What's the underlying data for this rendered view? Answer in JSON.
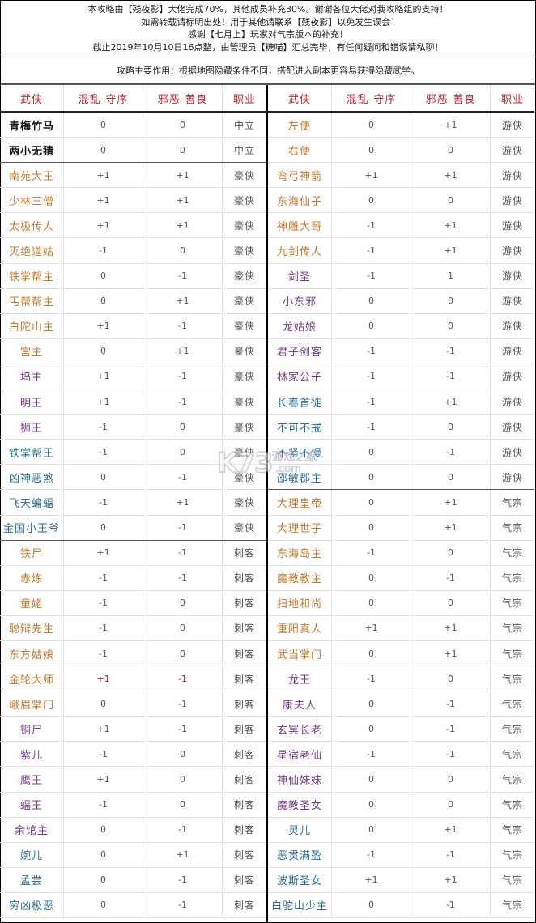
{
  "notice": {
    "lines": [
      "本攻略由【残夜影】大佬完成70%，其他成员补充30%。谢谢各位大佬对我攻略组的支持！",
      "如需转载请标明出处！用于其他请联系【残夜影】以免发生误会`",
      "感谢【七月上】玩家对气宗版本的补充！",
      "截止2019年10月10日16点整，由管理员【糖喵】汇总完毕，有任何疑问和错误请私聊！"
    ]
  },
  "purpose": "攻略主要作用：根据地图隐藏条件不同，搭配进入副本更容易获得隐藏武学。",
  "headers": [
    "武侠",
    "混乱-守序",
    "邪恶-善良",
    "职业"
  ],
  "colors": {
    "header": "#c0282f",
    "black": "#111111",
    "orange": "#c8782a",
    "purple": "#7a3a8c",
    "blue": "#2a6e9a",
    "highlight_value": "#b0202a"
  },
  "left_table": [
    {
      "name": "青梅竹马",
      "chaos_order": "0",
      "evil_good": "0",
      "job": "中立",
      "color": "black"
    },
    {
      "name": "两小无猜",
      "chaos_order": "0",
      "evil_good": "0",
      "job": "中立",
      "color": "black",
      "group_end": true
    },
    {
      "name": "南苑大王",
      "chaos_order": "+1",
      "evil_good": "+1",
      "job": "豪侠",
      "color": "orange"
    },
    {
      "name": "少林三僧",
      "chaos_order": "+1",
      "evil_good": "+1",
      "job": "豪侠",
      "color": "orange"
    },
    {
      "name": "太极传人",
      "chaos_order": "+1",
      "evil_good": "+1",
      "job": "豪侠",
      "color": "orange"
    },
    {
      "name": "灭绝道姑",
      "chaos_order": "-1",
      "evil_good": "0",
      "job": "豪侠",
      "color": "orange"
    },
    {
      "name": "铁掌帮主",
      "chaos_order": "0",
      "evil_good": "-1",
      "job": "豪侠",
      "color": "orange"
    },
    {
      "name": "丐帮帮主",
      "chaos_order": "0",
      "evil_good": "+1",
      "job": "豪侠",
      "color": "orange"
    },
    {
      "name": "白陀山主",
      "chaos_order": "+1",
      "evil_good": "-1",
      "job": "豪侠",
      "color": "orange"
    },
    {
      "name": "宫主",
      "chaos_order": "0",
      "evil_good": "+1",
      "job": "豪侠",
      "color": "orange"
    },
    {
      "name": "坞主",
      "chaos_order": "+1",
      "evil_good": "-1",
      "job": "豪侠",
      "color": "purple"
    },
    {
      "name": "明王",
      "chaos_order": "+1",
      "evil_good": "-1",
      "job": "豪侠",
      "color": "purple"
    },
    {
      "name": "狮王",
      "chaos_order": "-1",
      "evil_good": "0",
      "job": "豪侠",
      "color": "purple"
    },
    {
      "name": "铁掌帮王",
      "chaos_order": "-1",
      "evil_good": "0",
      "job": "豪侠",
      "color": "blue"
    },
    {
      "name": "凶神恶煞",
      "chaos_order": "0",
      "evil_good": "-1",
      "job": "豪侠",
      "color": "blue"
    },
    {
      "name": "飞天蝙蝠",
      "chaos_order": "-1",
      "evil_good": "+1",
      "job": "豪侠",
      "color": "blue"
    },
    {
      "name": "金国小王爷",
      "chaos_order": "0",
      "evil_good": "-1",
      "job": "豪侠",
      "color": "blue",
      "group_end": true
    },
    {
      "name": "铁尸",
      "chaos_order": "+1",
      "evil_good": "-1",
      "job": "刺客",
      "color": "orange"
    },
    {
      "name": "赤炼",
      "chaos_order": "-1",
      "evil_good": "-1",
      "job": "刺客",
      "color": "orange"
    },
    {
      "name": "童姥",
      "chaos_order": "-1",
      "evil_good": "0",
      "job": "刺客",
      "color": "orange"
    },
    {
      "name": "聪辩先生",
      "chaos_order": "-1",
      "evil_good": "0",
      "job": "刺客",
      "color": "orange"
    },
    {
      "name": "东方姑娘",
      "chaos_order": "-1",
      "evil_good": "0",
      "job": "刺客",
      "color": "orange"
    },
    {
      "name": "金轮大师",
      "chaos_order": "+1",
      "evil_good": "-1",
      "job": "刺客",
      "color": "orange",
      "values_highlight": true
    },
    {
      "name": "峨眉掌门",
      "chaos_order": "0",
      "evil_good": "-1",
      "job": "刺客",
      "color": "orange"
    },
    {
      "name": "铜尸",
      "chaos_order": "+1",
      "evil_good": "-1",
      "job": "刺客",
      "color": "purple"
    },
    {
      "name": "紫儿",
      "chaos_order": "-1",
      "evil_good": "0",
      "job": "刺客",
      "color": "purple"
    },
    {
      "name": "鹰王",
      "chaos_order": "+1",
      "evil_good": "0",
      "job": "刺客",
      "color": "purple"
    },
    {
      "name": "蝠王",
      "chaos_order": "-1",
      "evil_good": "0",
      "job": "刺客",
      "color": "purple"
    },
    {
      "name": "余馆主",
      "chaos_order": "0",
      "evil_good": "-1",
      "job": "刺客",
      "color": "purple"
    },
    {
      "name": "婉儿",
      "chaos_order": "0",
      "evil_good": "+1",
      "job": "刺客",
      "color": "blue"
    },
    {
      "name": "孟尝",
      "chaos_order": "0",
      "evil_good": "-1",
      "job": "刺客",
      "color": "blue"
    },
    {
      "name": "穷凶极恶",
      "chaos_order": "0",
      "evil_good": "-1",
      "job": "刺客",
      "color": "blue"
    }
  ],
  "right_table": [
    {
      "name": "左使",
      "chaos_order": "0",
      "evil_good": "+1",
      "job": "游侠",
      "color": "orange"
    },
    {
      "name": "右使",
      "chaos_order": "0",
      "evil_good": "0",
      "job": "游侠",
      "color": "orange"
    },
    {
      "name": "弯弓神箭",
      "chaos_order": "+1",
      "evil_good": "+1",
      "job": "游侠",
      "color": "orange"
    },
    {
      "name": "东海仙子",
      "chaos_order": "0",
      "evil_good": "0",
      "job": "游侠",
      "color": "orange"
    },
    {
      "name": "神雕大哥",
      "chaos_order": "-1",
      "evil_good": "+1",
      "job": "游侠",
      "color": "orange"
    },
    {
      "name": "九剑传人",
      "chaos_order": "-1",
      "evil_good": "+1",
      "job": "游侠",
      "color": "orange"
    },
    {
      "name": "剑圣",
      "chaos_order": "-1",
      "evil_good": "1",
      "job": "游侠",
      "color": "purple"
    },
    {
      "name": "小东邪",
      "chaos_order": "0",
      "evil_good": "0",
      "job": "游侠",
      "color": "purple"
    },
    {
      "name": "龙姑娘",
      "chaos_order": "0",
      "evil_good": "0",
      "job": "游侠",
      "color": "purple"
    },
    {
      "name": "君子剑客",
      "chaos_order": "-1",
      "evil_good": "-1",
      "job": "游侠",
      "color": "purple"
    },
    {
      "name": "林家公子",
      "chaos_order": "-1",
      "evil_good": "-1",
      "job": "游侠",
      "color": "purple"
    },
    {
      "name": "长春首徒",
      "chaos_order": "-1",
      "evil_good": "+1",
      "job": "游侠",
      "color": "blue"
    },
    {
      "name": "不可不戒",
      "chaos_order": "-1",
      "evil_good": "0",
      "job": "游侠",
      "color": "blue"
    },
    {
      "name": "不紧不慢",
      "chaos_order": "0",
      "evil_good": "-1",
      "job": "游侠",
      "color": "blue"
    },
    {
      "name": "邵敏郡主",
      "chaos_order": "0",
      "evil_good": "0",
      "job": "游侠",
      "color": "blue",
      "group_end": true
    },
    {
      "name": "大理皇帝",
      "chaos_order": "0",
      "evil_good": "+1",
      "job": "气宗",
      "color": "orange"
    },
    {
      "name": "大理世子",
      "chaos_order": "0",
      "evil_good": "+1",
      "job": "气宗",
      "color": "orange"
    },
    {
      "name": "东海岛主",
      "chaos_order": "-1",
      "evil_good": "0",
      "job": "气宗",
      "color": "orange"
    },
    {
      "name": "魔教教主",
      "chaos_order": "0",
      "evil_good": "-1",
      "job": "气宗",
      "color": "orange"
    },
    {
      "name": "扫地和尚",
      "chaos_order": "0",
      "evil_good": "0",
      "job": "气宗",
      "color": "orange"
    },
    {
      "name": "重阳真人",
      "chaos_order": "+1",
      "evil_good": "+1",
      "job": "气宗",
      "color": "orange"
    },
    {
      "name": "武当掌门",
      "chaos_order": "0",
      "evil_good": "+1",
      "job": "气宗",
      "color": "orange"
    },
    {
      "name": "龙王",
      "chaos_order": "-1",
      "evil_good": "0",
      "job": "气宗",
      "color": "purple"
    },
    {
      "name": "康夫人",
      "chaos_order": "0",
      "evil_good": "-1",
      "job": "气宗",
      "color": "purple"
    },
    {
      "name": "玄冥长老",
      "chaos_order": "0",
      "evil_good": "-1",
      "job": "气宗",
      "color": "purple"
    },
    {
      "name": "星宿老仙",
      "chaos_order": "-1",
      "evil_good": "-1",
      "job": "气宗",
      "color": "purple"
    },
    {
      "name": "神仙妹妹",
      "chaos_order": "0",
      "evil_good": "0",
      "job": "气宗",
      "color": "purple"
    },
    {
      "name": "魔教圣女",
      "chaos_order": "0",
      "evil_good": "0",
      "job": "气宗",
      "color": "purple"
    },
    {
      "name": "灵儿",
      "chaos_order": "0",
      "evil_good": "+1",
      "job": "气宗",
      "color": "blue"
    },
    {
      "name": "恶贯满盈",
      "chaos_order": "-1",
      "evil_good": "-1",
      "job": "气宗",
      "color": "blue"
    },
    {
      "name": "波斯圣女",
      "chaos_order": "+1",
      "evil_good": "+1",
      "job": "气宗",
      "color": "blue"
    },
    {
      "name": "白驼山少主",
      "chaos_order": "0",
      "evil_good": "-1",
      "job": "气宗",
      "color": "blue"
    }
  ],
  "watermark": {
    "logo": "K73",
    "site": "游戏之家",
    "domain": ".com"
  }
}
